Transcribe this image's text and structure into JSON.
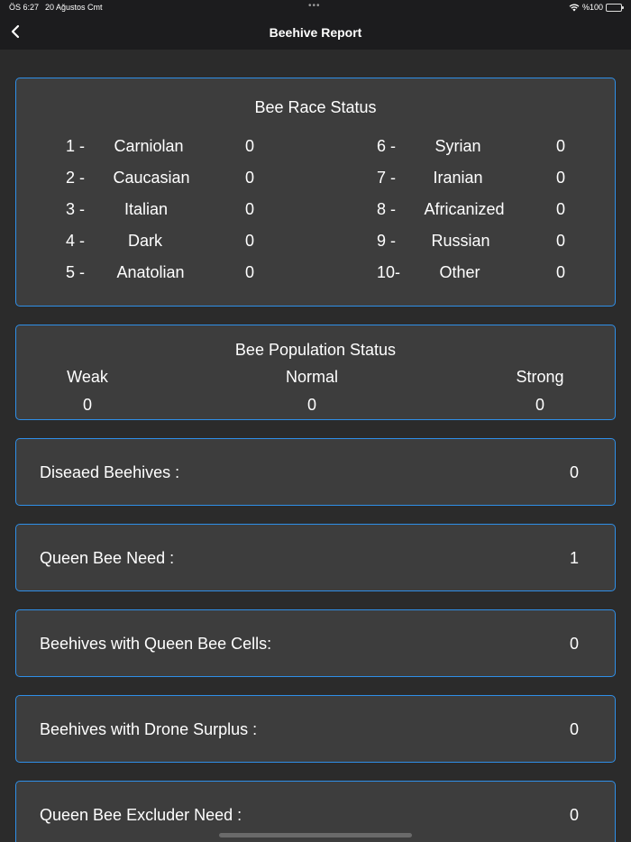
{
  "status_bar": {
    "time": "ÖS 6:27",
    "date": "20 Ağustos Cmt",
    "dots": "•••",
    "battery": "%100"
  },
  "nav": {
    "title": "Beehive Report"
  },
  "race_status": {
    "title": "Bee Race Status",
    "left": [
      {
        "num": "1 -",
        "name": "Carniolan",
        "value": "0"
      },
      {
        "num": "2 -",
        "name": "Caucasian",
        "value": "0"
      },
      {
        "num": "3 -",
        "name": "Italian",
        "value": "0"
      },
      {
        "num": "4 -",
        "name": "Dark",
        "value": "0"
      },
      {
        "num": "5 -",
        "name": "Anatolian",
        "value": "0"
      }
    ],
    "right": [
      {
        "num": "6 -",
        "name": "Syrian",
        "value": "0"
      },
      {
        "num": "7 -",
        "name": "Iranian",
        "value": "0"
      },
      {
        "num": "8 -",
        "name": "Africanized",
        "value": "0"
      },
      {
        "num": "9 -",
        "name": "Russian",
        "value": "0"
      },
      {
        "num": "10-",
        "name": "Other",
        "value": "0"
      }
    ]
  },
  "population_status": {
    "title": "Bee Population Status",
    "weak_label": "Weak",
    "weak_value": "0",
    "normal_label": "Normal",
    "normal_value": "0",
    "strong_label": "Strong",
    "strong_value": "0"
  },
  "rows": [
    {
      "label": "Diseaed Beehives :",
      "value": "0"
    },
    {
      "label": "Queen Bee Need :",
      "value": "1"
    },
    {
      "label": "Beehives with Queen Bee Cells:",
      "value": "0"
    },
    {
      "label": "Beehives with Drone Surplus :",
      "value": "0"
    },
    {
      "label": "Queen Bee Excluder Need :",
      "value": "0"
    }
  ],
  "colors": {
    "background": "#2b2b2b",
    "card": "#3d3d3d",
    "accent_border": "#2f8fe8",
    "topbar": "#1c1c1e"
  },
  "icons": [
    "back-chevron-icon",
    "wifi-icon",
    "battery-icon"
  ]
}
